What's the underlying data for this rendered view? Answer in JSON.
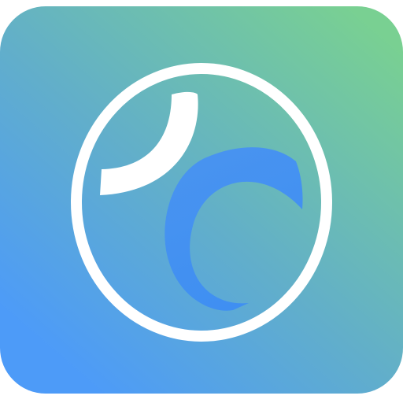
{
  "icon": {
    "name": "app-icon",
    "symbol": "circle-crescent-logo",
    "colors": {
      "background_start": "#79D092",
      "background_end": "#4D9BF8",
      "mark": "#FFFFFF",
      "inner_crescent": "#4593F5"
    }
  }
}
